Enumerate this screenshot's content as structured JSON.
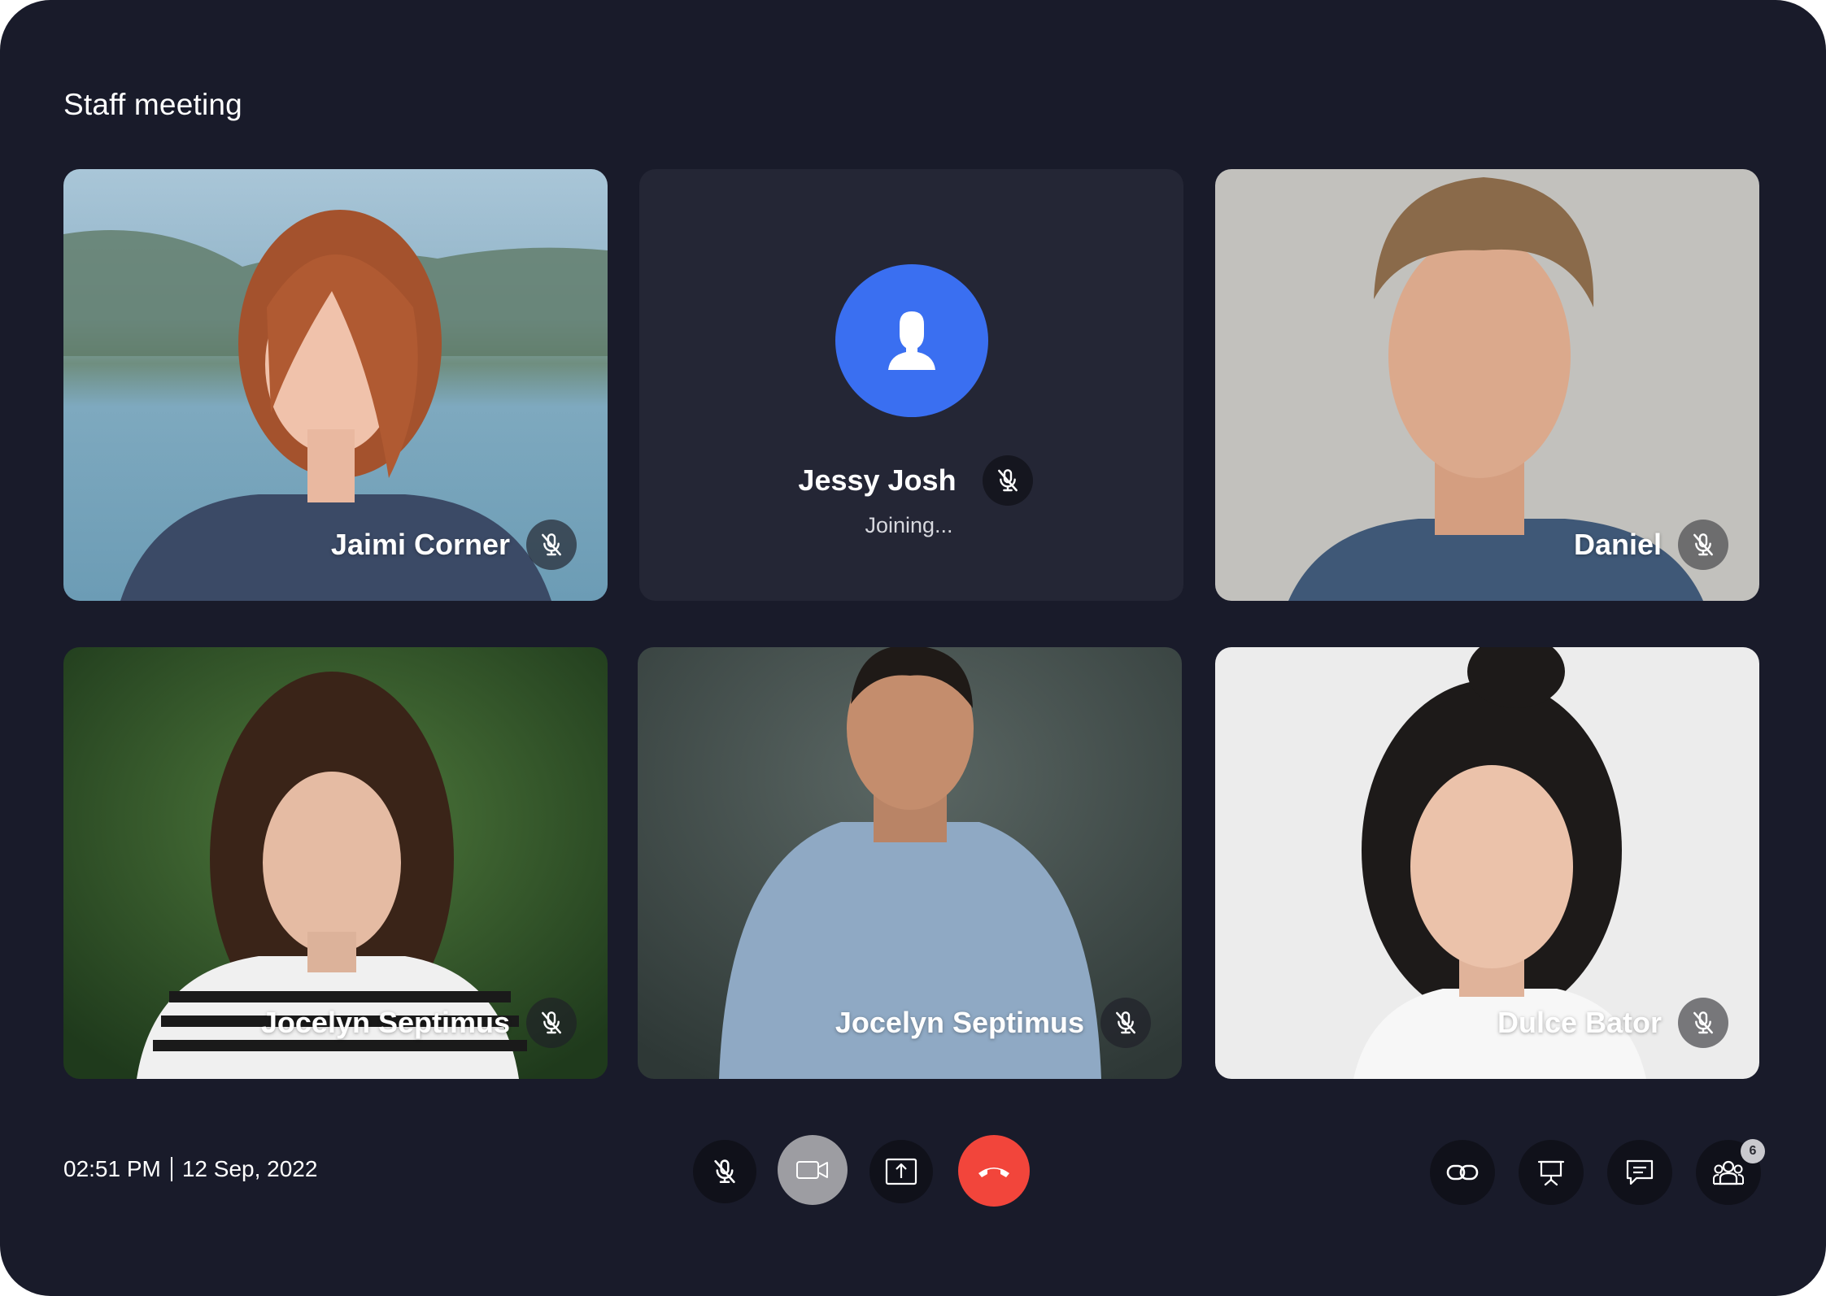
{
  "meeting": {
    "title": "Staff meeting"
  },
  "participants": [
    {
      "name": "Jaimi Corner",
      "muted": true
    },
    {
      "name": "Jessy Josh",
      "status": "Joining...",
      "muted": true
    },
    {
      "name": "Daniel",
      "muted": true
    },
    {
      "name": "Jocelyn Septimus",
      "muted": true
    },
    {
      "name": "Jocelyn Septimus",
      "muted": true
    },
    {
      "name": "Dulce Bator",
      "muted": true
    }
  ],
  "footer": {
    "time": "02:51 PM",
    "date": "12 Sep, 2022",
    "participant_count": "6"
  },
  "controls": {
    "center": [
      "mic-off-icon",
      "video-camera-icon",
      "share-screen-icon",
      "end-call-icon"
    ],
    "right": [
      "link-icon",
      "presentation-icon",
      "chat-icon",
      "participants-icon"
    ]
  },
  "colors": {
    "background": "#191b2a",
    "tile_placeholder": "#242635",
    "avatar_blue": "#3a6ff1",
    "end_call_red": "#f2453b",
    "camera_button": "#9d9da2"
  }
}
